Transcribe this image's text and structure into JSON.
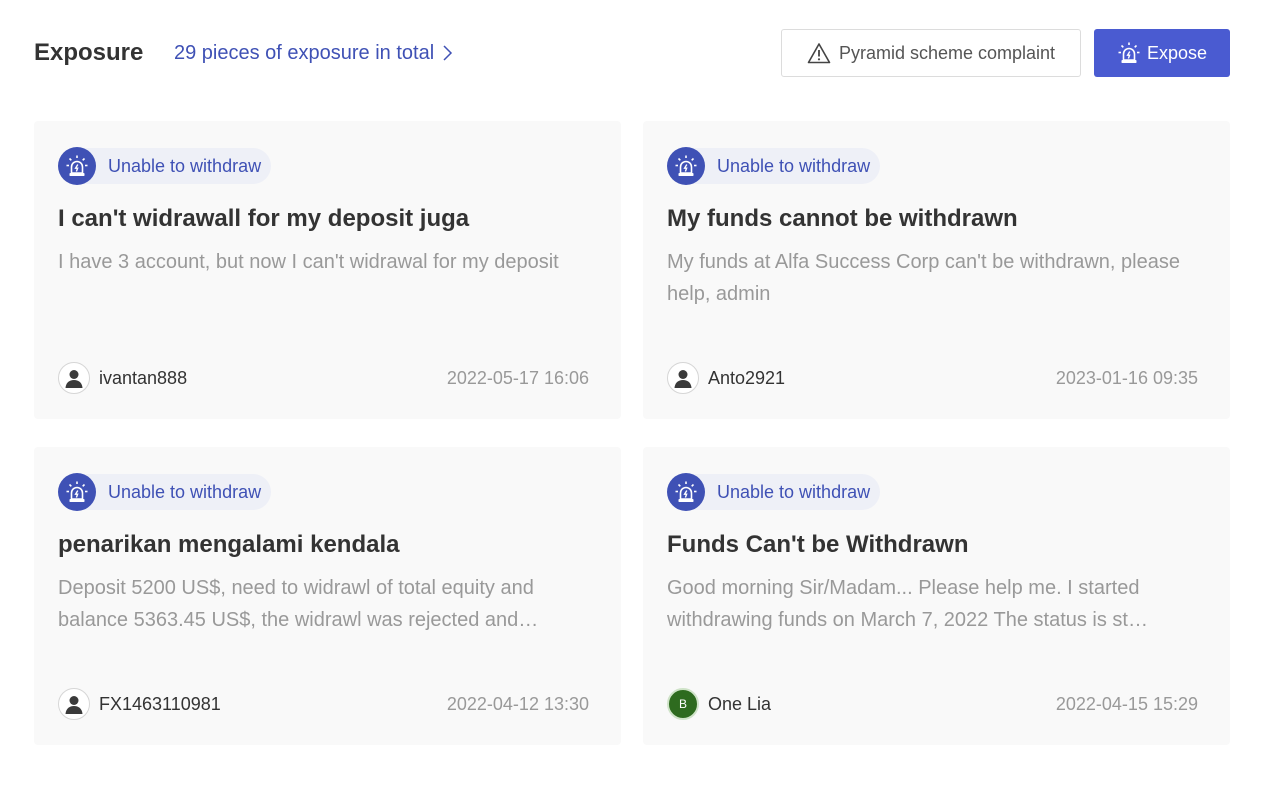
{
  "header": {
    "title": "Exposure",
    "total_link": "29 pieces of exposure in total",
    "complaint_button": "Pyramid scheme complaint",
    "expose_button": "Expose"
  },
  "cards": [
    {
      "tag": "Unable to withdraw",
      "title": "I can't widrawall for my deposit juga",
      "desc": "I have 3 account, but now I can't widrawal for my deposit",
      "user": "ivantan888",
      "avatar": "user-silhouette-icon",
      "date": "2022-05-17 16:06"
    },
    {
      "tag": "Unable to withdraw",
      "title": "My funds cannot be withdrawn",
      "desc": "My funds at Alfa Success Corp can't be withdrawn, please help, admin",
      "user": "Anto2921",
      "avatar": "user-silhouette-icon",
      "date": "2023-01-16 09:35"
    },
    {
      "tag": "Unable to withdraw",
      "title": "penarikan mengalami kendala",
      "desc": "Deposit 5200 US$, need to widrawl of total equity and balance 5363.45 US$, the widrawl was rejected and…",
      "user": "FX1463110981",
      "avatar": "user-silhouette-icon",
      "date": "2022-04-12 13:30"
    },
    {
      "tag": "Unable to withdraw",
      "title": "Funds Can't be Withdrawn",
      "desc": "Good morning Sir/Madam... Please help me. I started withdrawing funds on March 7, 2022 The status is st…",
      "user": "One Lia",
      "avatar_letter": "B",
      "date": "2022-04-15 15:29"
    }
  ],
  "colors": {
    "accent": "#3f51b5",
    "button_primary": "#4a5bd1",
    "card_bg": "#f9f9f9",
    "muted_text": "#999999"
  }
}
